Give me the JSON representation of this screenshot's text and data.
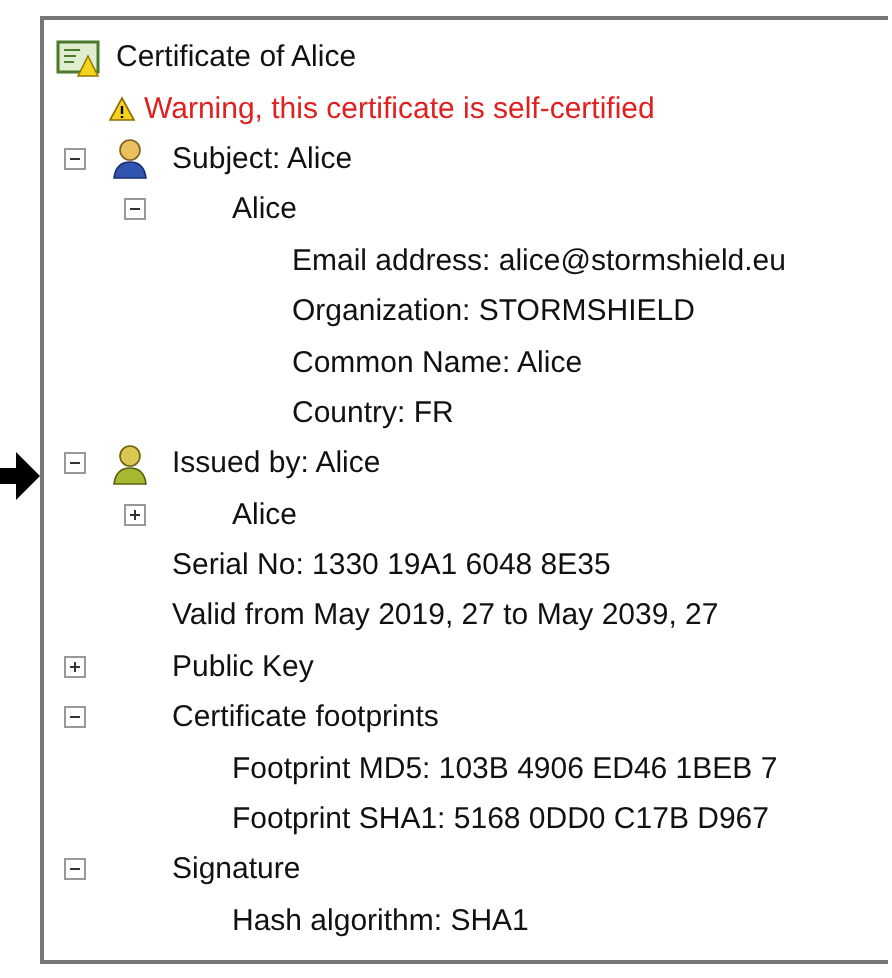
{
  "tree": {
    "label": "Certificate of Alice",
    "kind": "certificate",
    "children": [
      {
        "label": "Warning, this certificate is self-certified",
        "kind": "warning"
      },
      {
        "label": "Subject: Alice",
        "kind": "subject",
        "expanded": true,
        "children": [
          {
            "label": "Alice",
            "expanded": true,
            "children": [
              {
                "label": "Email address: alice@stormshield.eu"
              },
              {
                "label": "Organization: STORMSHIELD"
              },
              {
                "label": "Common Name: Alice"
              },
              {
                "label": "Country: FR"
              }
            ]
          }
        ]
      },
      {
        "label": "Issued by: Alice",
        "kind": "issuer",
        "expanded": true,
        "children": [
          {
            "label": "Alice",
            "expanded": false
          }
        ]
      },
      {
        "label": "Serial No: 1330 19A1 6048 8E35"
      },
      {
        "label": "Valid from May 2019, 27 to May 2039, 27"
      },
      {
        "label": "Public Key",
        "expanded": false
      },
      {
        "label": "Certificate footprints",
        "expanded": true,
        "children": [
          {
            "label": "Footprint MD5: 103B 4906 ED46 1BEB 7"
          },
          {
            "label": "Footprint SHA1: 5168 0DD0 C17B D967"
          }
        ]
      },
      {
        "label": "Signature",
        "expanded": true,
        "children": [
          {
            "label": "Hash algorithm: SHA1"
          }
        ]
      }
    ]
  }
}
